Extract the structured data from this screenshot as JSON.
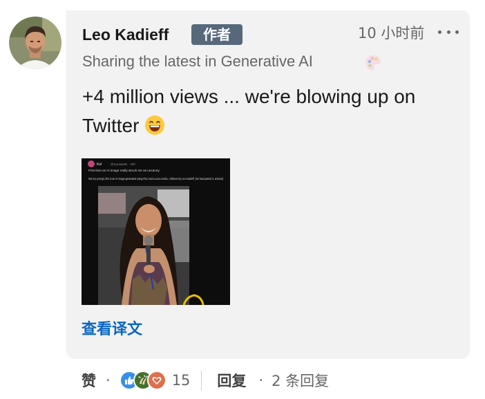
{
  "comment": {
    "author": {
      "name": "Leo Kadieff",
      "badge": "作者",
      "headline": "Sharing the latest in Generative AI",
      "headline_icon": "palette-icon"
    },
    "time": "10 小时前",
    "more_icon": "more-options-icon",
    "text": "+4 million views ... we're blowing up on Twitter",
    "text_emoji": "grinning-face-icon",
    "attachment": {
      "kind": "tweet screenshot image",
      "tweet_author": "Kel",
      "tweet_handle": "@Kyrawatts · 19h",
      "tweet_line1": "First time an AI image really struck me as uncanny.",
      "tweet_line2": "Not my prompt, this is an AI image generated using Flux and a Lora combo, I believe by Leo Kadieff. (He had posted it, at least)"
    },
    "translate_label": "查看译文"
  },
  "actions": {
    "like_label": "赞",
    "separator": "·",
    "reaction_icons": [
      "like-reaction-icon",
      "celebrate-reaction-icon",
      "love-reaction-icon"
    ],
    "reaction_count": "15",
    "reply_label": "回复",
    "reply_count": "2 条回复"
  },
  "colors": {
    "bubble_bg": "#f2f2f2",
    "badge_bg": "#56687a",
    "link_blue": "#0a66c2",
    "muted_text": "#666666"
  }
}
